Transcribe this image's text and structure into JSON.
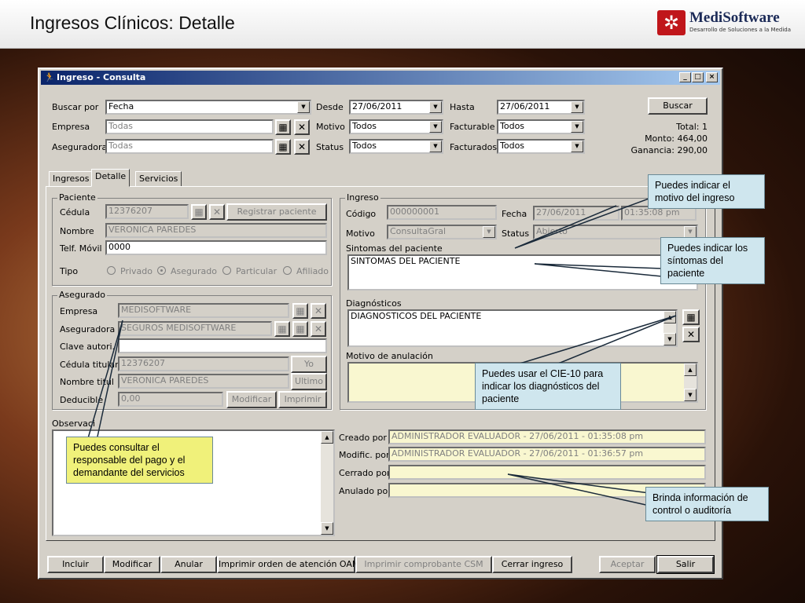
{
  "slide": {
    "title": "Ingresos Clínicos: Detalle",
    "logo_name": "MediSoftware",
    "logo_tagline": "Desarrollo de Soluciones a la Medida",
    "logo_icon": "medisoftware-logo-icon"
  },
  "window": {
    "title": "Ingreso - Consulta",
    "min": "_",
    "max": "□",
    "close": "×"
  },
  "filters": {
    "buscar_por": {
      "label": "Buscar por",
      "value": "Fecha"
    },
    "empresa": {
      "label": "Empresa",
      "value": "Todas"
    },
    "aseguradora": {
      "label": "Aseguradora",
      "value": "Todas"
    },
    "desde": {
      "label": "Desde",
      "value": "27/06/2011"
    },
    "motivo": {
      "label": "Motivo",
      "value": "Todos"
    },
    "status": {
      "label": "Status",
      "value": "Todos"
    },
    "hasta": {
      "label": "Hasta",
      "value": "27/06/2011"
    },
    "facturable": {
      "label": "Facturable",
      "value": "Todos"
    },
    "facturados": {
      "label": "Facturados",
      "value": "Todos"
    },
    "buscar_btn": "Buscar",
    "total": "Total: 1",
    "monto": "Monto: 464,00",
    "ganancia": "Ganancia: 290,00"
  },
  "tabs": [
    "Ingresos",
    "Detalle",
    "Servicios"
  ],
  "paciente": {
    "group": "Paciente",
    "cedula_label": "Cédula",
    "cedula": "12376207",
    "registrar_btn": "Registrar paciente",
    "nombre_label": "Nombre",
    "nombre": "VERONICA PAREDES",
    "telf_label": "Telf. Móvil",
    "telf": "0000",
    "tipo_label": "Tipo",
    "tipos": [
      "Privado",
      "Asegurado",
      "Particular",
      "Afiliado"
    ]
  },
  "asegurado": {
    "group": "Asegurado",
    "empresa_label": "Empresa",
    "empresa": "MEDISOFTWARE",
    "aseguradora_label": "Aseguradora",
    "aseguradora": "SEGUROS MEDISOFTWARE",
    "clave_label": "Clave autori.",
    "clave": "",
    "cedula_label": "Cédula titular",
    "cedula": "12376207",
    "yo_btn": "Yo",
    "nombre_label": "Nombre titul",
    "nombre": "VERONICA PAREDES",
    "ultimo_btn": "Ultimo",
    "deducible_label": "Deducible",
    "deducible": "0,00",
    "modificar_btn": "Modificar",
    "imprimir_btn": "Imprimir"
  },
  "observaciones_label": "Observaci",
  "ingreso": {
    "group": "Ingreso",
    "codigo_label": "Código",
    "codigo": "000000001",
    "fecha_label": "Fecha",
    "fecha": "27/06/2011",
    "hora": "01:35:08 pm",
    "motivo_label": "Motivo",
    "motivo": "ConsultaGral",
    "status_label": "Status",
    "status": "Abierto",
    "sintomas_label": "Sintomas del paciente",
    "sintomas": "SINTOMAS DEL PACIENTE",
    "diag_label": "Diagnósticos",
    "diag": "DIAGNOSTICOS DEL PACIENTE",
    "anulacion_label": "Motivo de anulación",
    "anulacion": ""
  },
  "audit": {
    "creado_label": "Creado por",
    "creado": "ADMINISTRADOR EVALUADOR - 27/06/2011 - 01:35:08 pm",
    "modif_label": "Modific. por",
    "modif": "ADMINISTRADOR EVALUADOR - 27/06/2011 - 01:36:57 pm",
    "cerrado_label": "Cerrado por",
    "cerrado": "",
    "anulado_label": "Anulado por",
    "anulado": ""
  },
  "toolbar": {
    "incluir": "Incluir",
    "modificar": "Modificar",
    "anular": "Anular",
    "imprimir_orden": "Imprimir orden de atención OAM",
    "imprimir_comprobante": "Imprimir comprobante CSM",
    "cerrar": "Cerrar ingreso",
    "aceptar": "Aceptar",
    "salir": "Salir"
  },
  "callouts": {
    "motivo": "Puedes indicar el motivo del ingreso",
    "sintomas": "Puedes indicar los síntomas del paciente",
    "cie10": "Puedes usar el CIE-10 para indicar los diagnósticos del paciente",
    "responsable": "Puedes consultar el responsable del pago y el demandante del servicios",
    "auditoria": "Brinda información de control o auditoría"
  },
  "colors": {
    "callout_blue": "#cfe6ee",
    "callout_yellow": "#f0f17a",
    "titlebar": "#0a246a",
    "brand_red": "#c0161b"
  }
}
